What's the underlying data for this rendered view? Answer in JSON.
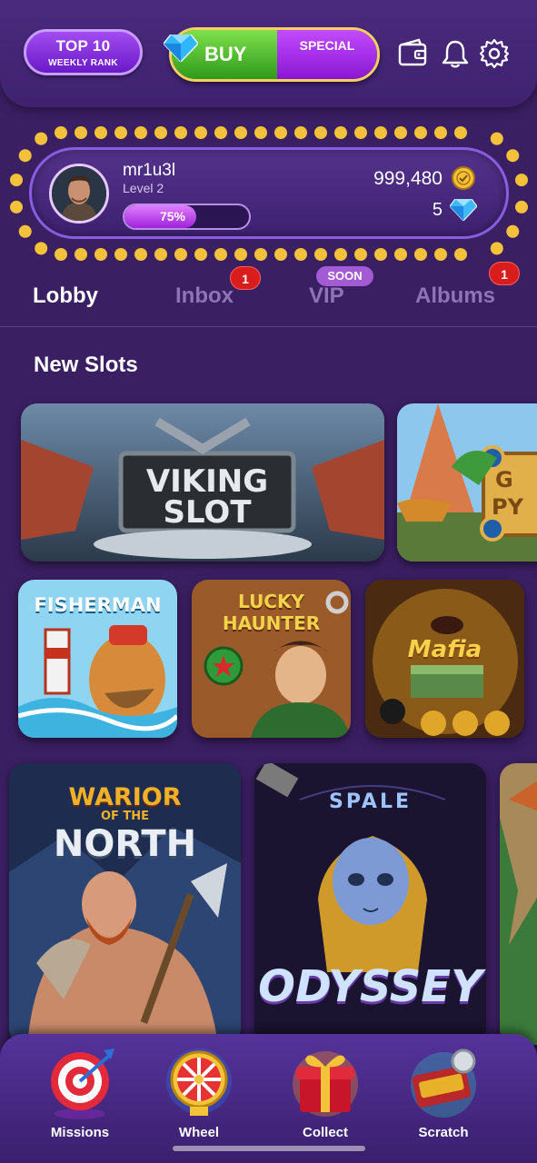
{
  "header": {
    "rank_line1": "TOP 10",
    "rank_line2": "WEEKLY RANK",
    "buy_label": "BUY",
    "special_label": "SPECIAL",
    "icons": [
      "wallet-icon",
      "bell-icon",
      "gear-icon"
    ]
  },
  "profile": {
    "username": "mr1u3l",
    "level": "Level 2",
    "xp_percent": 75,
    "xp_text": "75%",
    "coins": "999,480",
    "gems": "5"
  },
  "tabs": [
    {
      "label": "Lobby",
      "active": true
    },
    {
      "label": "Inbox",
      "badge": "1"
    },
    {
      "label": "VIP",
      "tag": "SOON"
    },
    {
      "label": "Albums",
      "badge": "1"
    }
  ],
  "section": {
    "title": "New Slots"
  },
  "games": {
    "viking": {
      "line1": "VIKING",
      "line2": "SLOT"
    },
    "pyramid": {
      "line1": "G",
      "line2": "PY"
    },
    "fisherman": {
      "title": "FISHERMAN"
    },
    "lucky": {
      "line1": "LUCKY",
      "line2": "HAUNTER"
    },
    "mafia": {
      "title": "Mafia"
    },
    "warrior": {
      "line1": "WARIOR",
      "line2": "OF THE",
      "line3": "NORTH"
    },
    "space": {
      "line1": "SPALE",
      "line2": "ODYSSEY"
    }
  },
  "bottom_nav": [
    {
      "label": "Missions",
      "icon": "target-icon"
    },
    {
      "label": "Wheel",
      "icon": "wheel-icon"
    },
    {
      "label": "Collect",
      "icon": "gift-icon"
    },
    {
      "label": "Scratch",
      "icon": "scratch-card-icon"
    }
  ],
  "colors": {
    "background": "#3b1f63",
    "accent_purple": "#8a17d3",
    "buy_green": "#2e9a1c",
    "badge_red": "#d91c1c",
    "gold": "#f3c23a"
  }
}
